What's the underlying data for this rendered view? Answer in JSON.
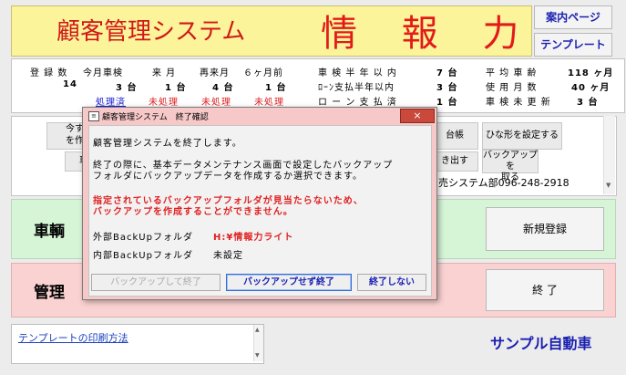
{
  "banner": {
    "subtitle": "顧客管理システム",
    "title": "情 報 力"
  },
  "top_buttons": {
    "guide": "案内ページ",
    "template": "テンプレート"
  },
  "stats": {
    "col_headers": [
      "登 録 数",
      "今月車検",
      "来 月",
      "再来月",
      "６ヶ月前"
    ],
    "col_values": [
      "14",
      "3 台",
      "1 台",
      "4 台",
      "1 台"
    ],
    "status": [
      "処理済",
      "未処理",
      "未処理",
      "未処理"
    ],
    "mid_labels": [
      "車 検 半 年 以 内",
      "ﾛｰﾝ支払半年以内",
      "ロ ー ン 支 払 済"
    ],
    "mid_values": [
      "7 台",
      "3 台",
      "1 台"
    ],
    "right_labels": [
      "平 均 車 齢",
      "使 用 月 数",
      "車 検 未 更 新"
    ],
    "right_values": [
      "118 ヶ月",
      "40 ヶ月",
      "3 台"
    ]
  },
  "mid_panel": {
    "left_btn_line1": "今す",
    "left_btn_line2": "を作",
    "left_btn2": "車",
    "right_btn_daichou": "台帳",
    "right_btn_kakidashi": "き出す",
    "template_btn": "ひな形を設定する",
    "backup_btn_line1": "バックアップを",
    "backup_btn_line2": "取る",
    "contact": "売システム部096-248-2918"
  },
  "rows": {
    "vehicle_label": "車輌",
    "new_register": "新規登録",
    "manage_label": "管理",
    "exit": "終 了"
  },
  "bottom": {
    "link": "テンプレートの印刷方法",
    "company": "サンプル自動車"
  },
  "dialog": {
    "title": "顧客管理システム　終了確認",
    "line1": "顧客管理システムを終了します。",
    "line2": "終了の際に、基本データメンテナンス画面で設定したバックアップ",
    "line3": "フォルダにバックアップデータを作成するか選択できます。",
    "warn1": "指定されているバックアップフォルダが見当たらないため、",
    "warn2": "バックアップを作成することができません。",
    "ext_label": "外部BackUpフォルダ",
    "ext_value": "H:¥情報力ライト",
    "int_label": "内部BackUpフォルダ",
    "int_value": "未設定",
    "btn_backup_exit": "バックアップして終了",
    "btn_no_backup_exit": "バックアップせず終了",
    "btn_cancel": "終了しない",
    "close_icon": "×"
  }
}
